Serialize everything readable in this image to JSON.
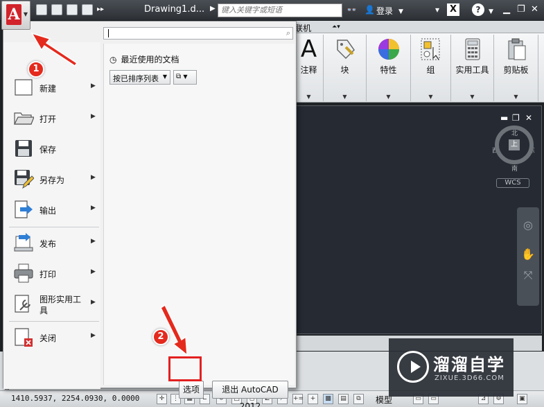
{
  "titlebar": {
    "doc_title": "Drawing1.d...",
    "search_placeholder": "键入关键字或短语",
    "login": "登录"
  },
  "ribbon": {
    "tab_partial": "联机",
    "panels": [
      {
        "label": "注释"
      },
      {
        "label": "块"
      },
      {
        "label": "特性"
      },
      {
        "label": "组"
      },
      {
        "label": "实用工具"
      },
      {
        "label": "剪贴板"
      }
    ]
  },
  "viewcube": {
    "face": "上",
    "north": "北",
    "south": "南",
    "east": "东",
    "west": "西",
    "wcs": "WCS"
  },
  "app_menu": {
    "items": [
      {
        "label": "新建",
        "icon": "new-file-icon",
        "arrow": true
      },
      {
        "label": "打开",
        "icon": "open-folder-icon",
        "arrow": true
      },
      {
        "label": "保存",
        "icon": "save-disk-icon",
        "arrow": false
      },
      {
        "label": "另存为",
        "icon": "save-as-icon",
        "arrow": true
      },
      {
        "label": "输出",
        "icon": "export-icon",
        "arrow": true
      },
      {
        "label": "发布",
        "icon": "publish-icon",
        "arrow": true
      },
      {
        "label": "打印",
        "icon": "printer-icon",
        "arrow": true
      },
      {
        "label": "图形实用工具",
        "icon": "drawing-utilities-icon",
        "arrow": true
      },
      {
        "label": "关闭",
        "icon": "close-file-icon",
        "arrow": true
      }
    ],
    "recent_title": "最近使用的文档",
    "sort_label": "按已排序列表",
    "options_button": "选项",
    "exit_button": "退出 AutoCAD 2012"
  },
  "annotations": {
    "badge1": "1",
    "badge2": "2",
    "color": "#e42a1d"
  },
  "statusbar": {
    "coords": "1410.5937, 2254.0930, 0.0000",
    "model": "模型"
  },
  "watermark": {
    "title": "溜溜自学",
    "subtitle": "ZIXUE.3D66.COM"
  }
}
